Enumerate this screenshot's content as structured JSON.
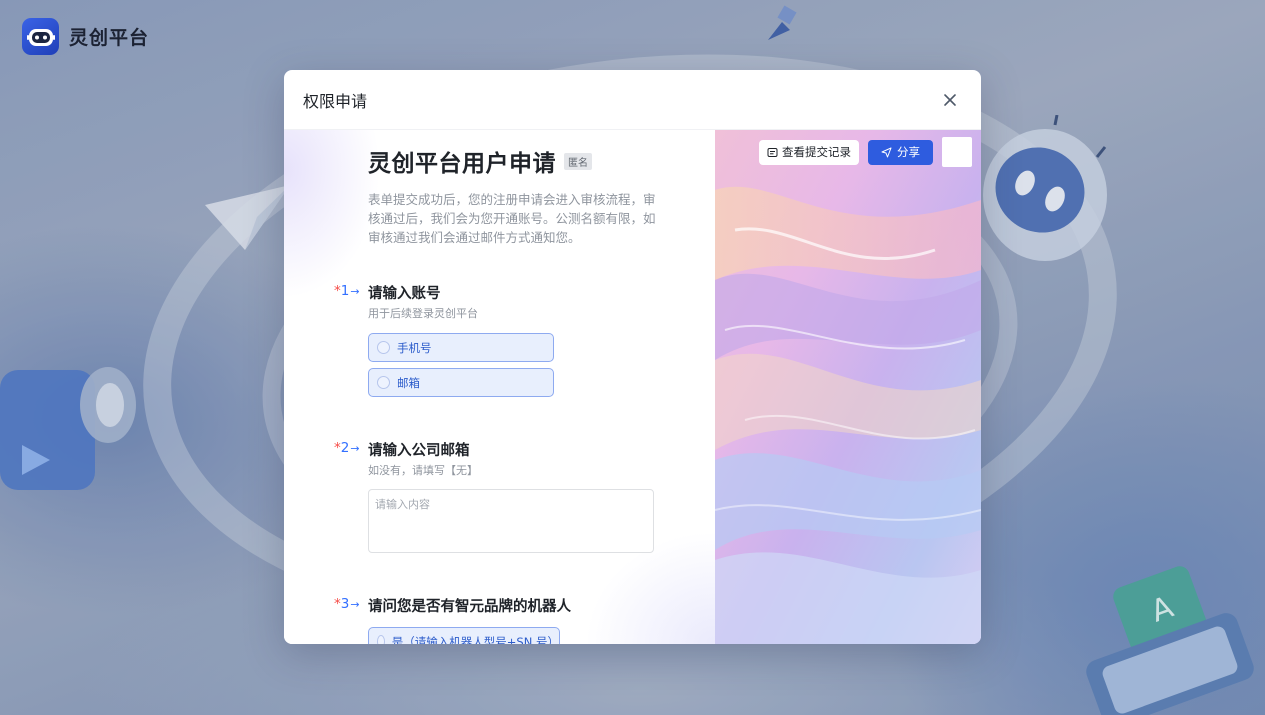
{
  "app": {
    "name": "灵创平台"
  },
  "modal": {
    "title": "权限申请",
    "actions": {
      "records_label": "查看提交记录",
      "share_label": "分享"
    }
  },
  "form": {
    "title": "灵创平台用户申请",
    "badge": "匿名",
    "description": "表单提交成功后，您的注册申请会进入审核流程，审核通过后，我们会为您开通账号。公测名额有限，如审核通过我们会通过邮件方式通知您。",
    "questions": [
      {
        "required_mark": "*",
        "number": "1",
        "title": "请输入账号",
        "subtitle": "用于后续登录灵创平台",
        "options": [
          "手机号",
          "邮箱"
        ]
      },
      {
        "required_mark": "*",
        "number": "2",
        "title": "请输入公司邮箱",
        "subtitle": "如没有，请填写【无】",
        "value": "",
        "placeholder": "请输入内容"
      },
      {
        "required_mark": "*",
        "number": "3",
        "title": "请问您是否有智元品牌的机器人",
        "options": [
          "是（请输入机器人型号+SN 号）"
        ]
      }
    ]
  },
  "colors": {
    "accent": "#2e5cdf",
    "required": "#f54a45",
    "option_bg": "#e8effd",
    "option_border": "#8eaaf0"
  }
}
